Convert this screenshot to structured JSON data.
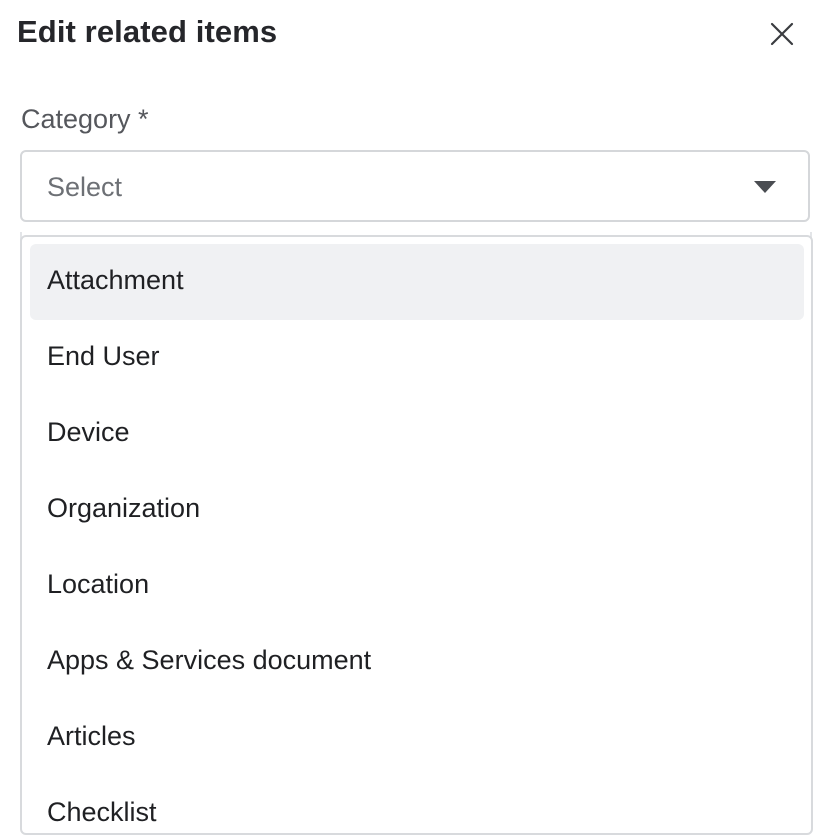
{
  "dialog": {
    "title": "Edit related items",
    "close_icon": "close-icon"
  },
  "category_field": {
    "label": "Category *",
    "placeholder": "Select",
    "caret_icon": "caret-down-icon"
  },
  "dropdown": {
    "highlighted_index": 0,
    "options": [
      {
        "label": "Attachment"
      },
      {
        "label": "End User"
      },
      {
        "label": "Device"
      },
      {
        "label": "Organization"
      },
      {
        "label": "Location"
      },
      {
        "label": "Apps & Services document"
      },
      {
        "label": "Articles"
      },
      {
        "label": "Checklist"
      }
    ]
  },
  "colors": {
    "highlight": "#f0f1f3",
    "border": "#d5d7da",
    "text": "#1f2023",
    "muted_text": "#6d7075"
  }
}
